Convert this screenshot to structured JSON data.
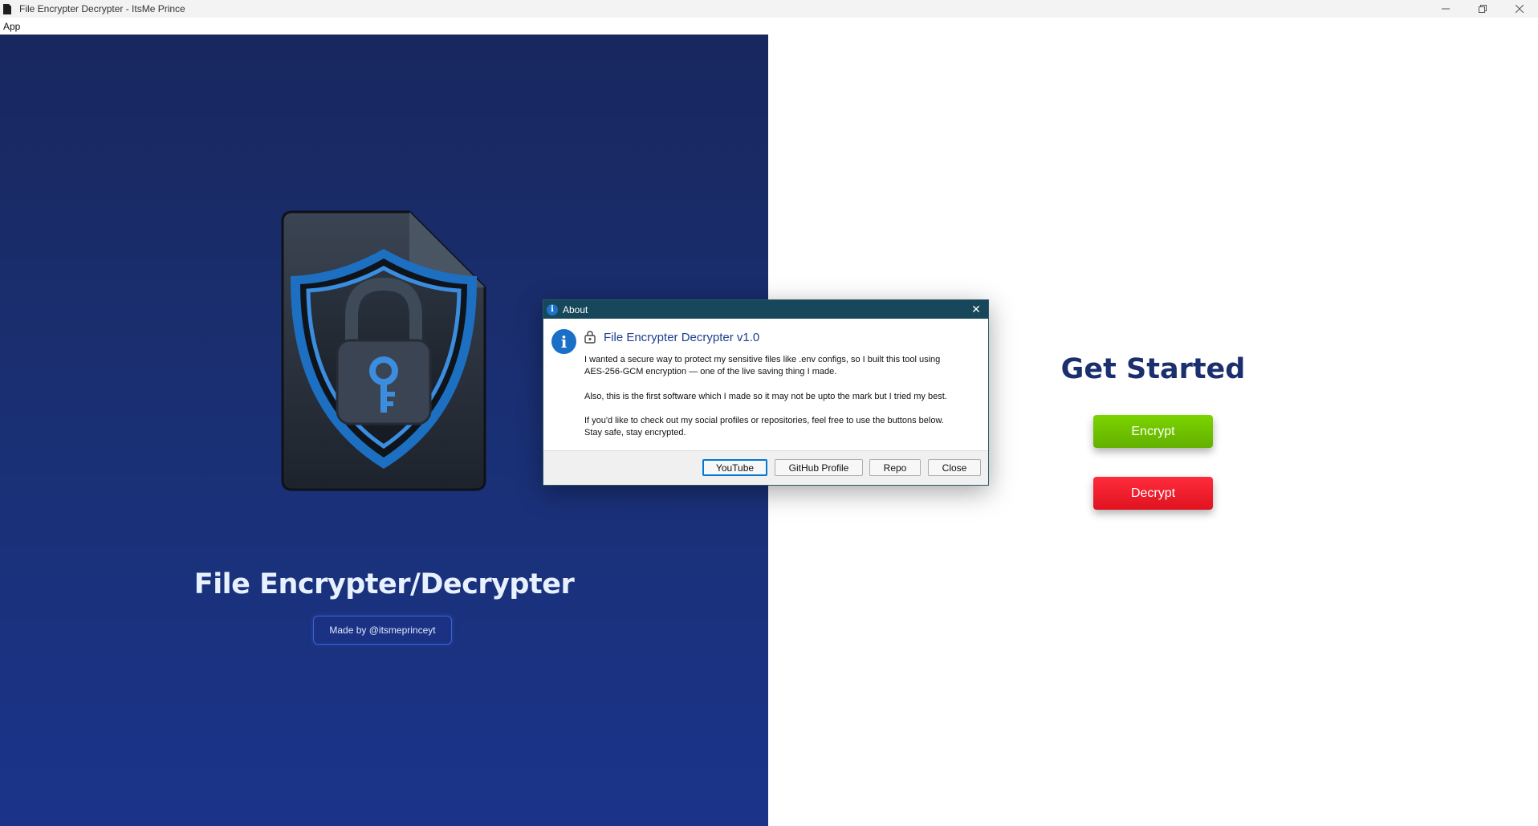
{
  "window": {
    "title": "File Encrypter Decrypter - ItsMe Prince",
    "controls": {
      "minimize": "–",
      "maximize": "❐",
      "close": "✕"
    }
  },
  "menubar": {
    "items": [
      {
        "label": "App"
      }
    ]
  },
  "left": {
    "title": "File Encrypter/Decrypter",
    "made_by": "Made by @itsmeprinceyt",
    "logo_icon": "shield-lock-file-icon"
  },
  "right": {
    "heading": "Get Started",
    "encrypt_label": "Encrypt",
    "decrypt_label": "Decrypt",
    "colors": {
      "encrypt": "#6cc000",
      "decrypt": "#ef1c2b",
      "heading": "#1b2f6e"
    }
  },
  "dialog": {
    "title": "About",
    "title_icon": "i",
    "close_glyph": "✕",
    "info_glyph": "i",
    "heading": "File Encrypter Decrypter v1.0",
    "paragraphs": {
      "p1_line1": "I wanted a secure way to protect my sensitive files like .env configs, so I built this tool using",
      "p1_line2": "AES-256-GCM encryption — one of the live saving thing I made.",
      "p2": "Also, this is the first software which I made so it may not be upto the mark but I tried my best.",
      "p3_line1": "If you'd like to check out my social profiles or repositories, feel free to use the buttons below.",
      "p3_line2": "Stay safe, stay encrypted."
    },
    "buttons": {
      "youtube": "YouTube",
      "github": "GitHub Profile",
      "repo": "Repo",
      "close": "Close"
    }
  }
}
